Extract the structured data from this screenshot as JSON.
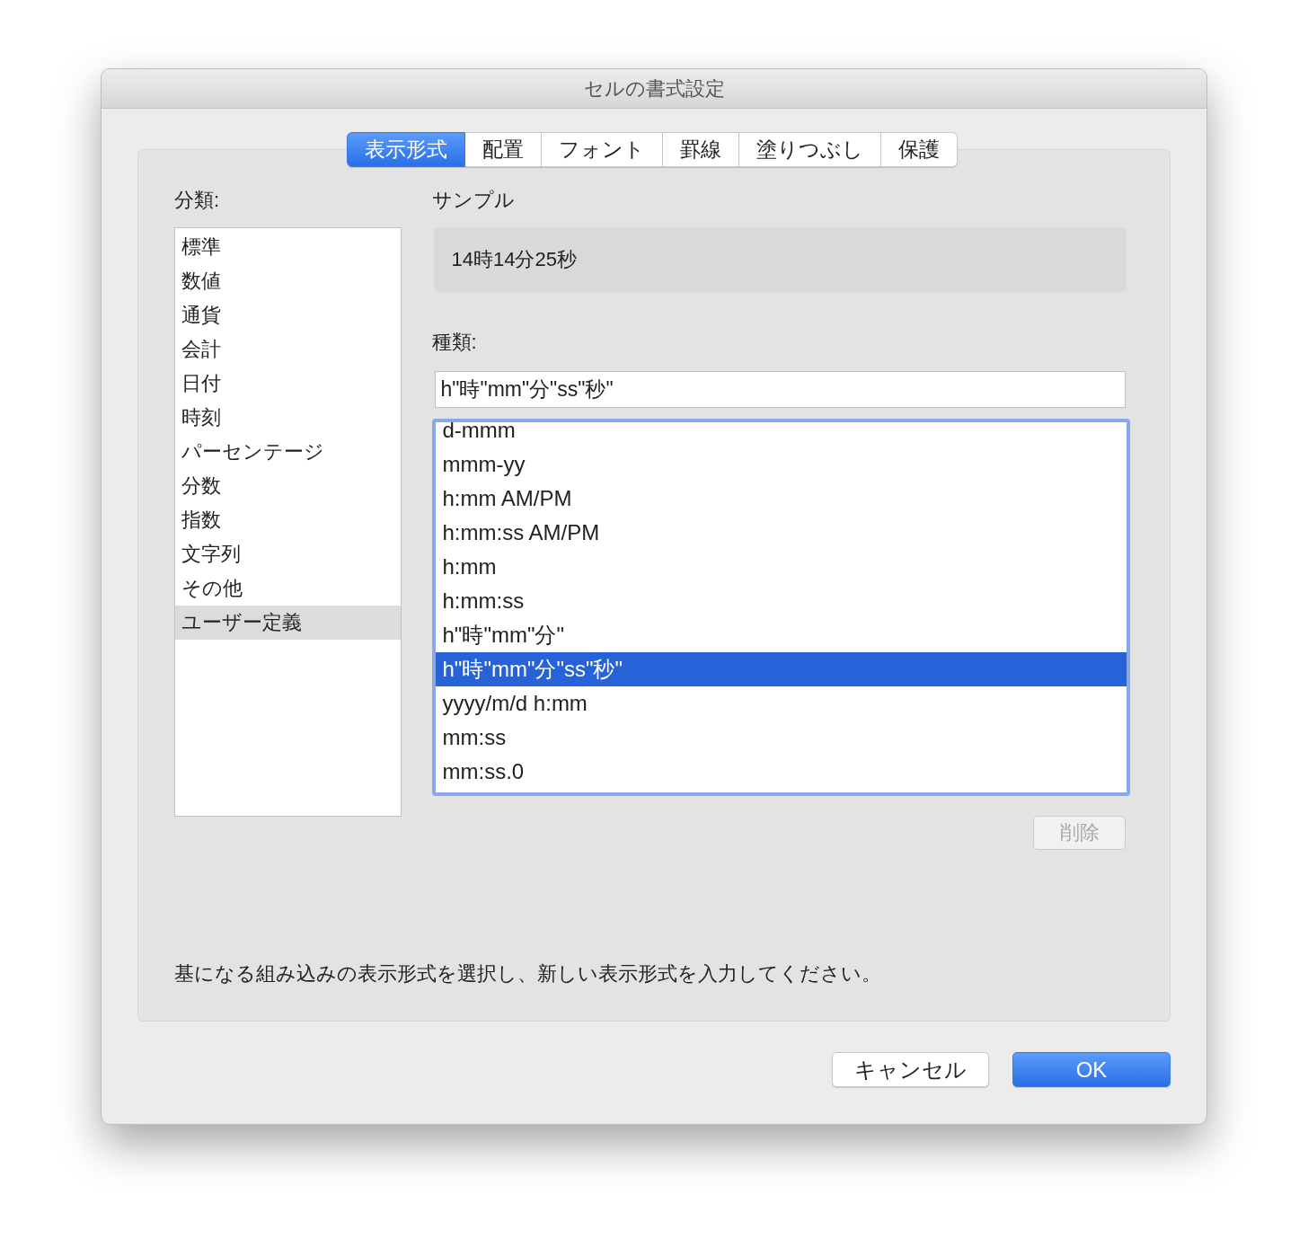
{
  "window": {
    "title": "セルの書式設定"
  },
  "tabs": [
    {
      "label": "表示形式",
      "selected": true
    },
    {
      "label": "配置",
      "selected": false
    },
    {
      "label": "フォント",
      "selected": false
    },
    {
      "label": "罫線",
      "selected": false
    },
    {
      "label": "塗りつぶし",
      "selected": false
    },
    {
      "label": "保護",
      "selected": false
    }
  ],
  "category_label": "分類:",
  "categories": [
    {
      "label": "標準",
      "selected": false
    },
    {
      "label": "数値",
      "selected": false
    },
    {
      "label": "通貨",
      "selected": false
    },
    {
      "label": "会計",
      "selected": false
    },
    {
      "label": "日付",
      "selected": false
    },
    {
      "label": "時刻",
      "selected": false
    },
    {
      "label": "パーセンテージ",
      "selected": false
    },
    {
      "label": "分数",
      "selected": false
    },
    {
      "label": "指数",
      "selected": false
    },
    {
      "label": "文字列",
      "selected": false
    },
    {
      "label": "その他",
      "selected": false
    },
    {
      "label": "ユーザー定義",
      "selected": true
    }
  ],
  "sample": {
    "label": "サンプル",
    "value": "14時14分25秒"
  },
  "type_label": "種類:",
  "type_field": {
    "value": "h\"時\"mm\"分\"ss\"秒\""
  },
  "formats": [
    {
      "label": "d-mmm",
      "selected": false
    },
    {
      "label": "mmm-yy",
      "selected": false
    },
    {
      "label": "h:mm AM/PM",
      "selected": false
    },
    {
      "label": "h:mm:ss AM/PM",
      "selected": false
    },
    {
      "label": "h:mm",
      "selected": false
    },
    {
      "label": "h:mm:ss",
      "selected": false
    },
    {
      "label": "h\"時\"mm\"分\"",
      "selected": false
    },
    {
      "label": "h\"時\"mm\"分\"ss\"秒\"",
      "selected": true
    },
    {
      "label": "yyyy/m/d h:mm",
      "selected": false
    },
    {
      "label": "mm:ss",
      "selected": false
    },
    {
      "label": "mm:ss.0",
      "selected": false
    }
  ],
  "delete_button": {
    "label": "削除",
    "disabled": true
  },
  "hint": "基になる組み込みの表示形式を選択し、新しい表示形式を入力してください。",
  "buttons": [
    {
      "label": "キャンセル",
      "kind": "secondary"
    },
    {
      "label": "OK",
      "kind": "primary"
    }
  ]
}
